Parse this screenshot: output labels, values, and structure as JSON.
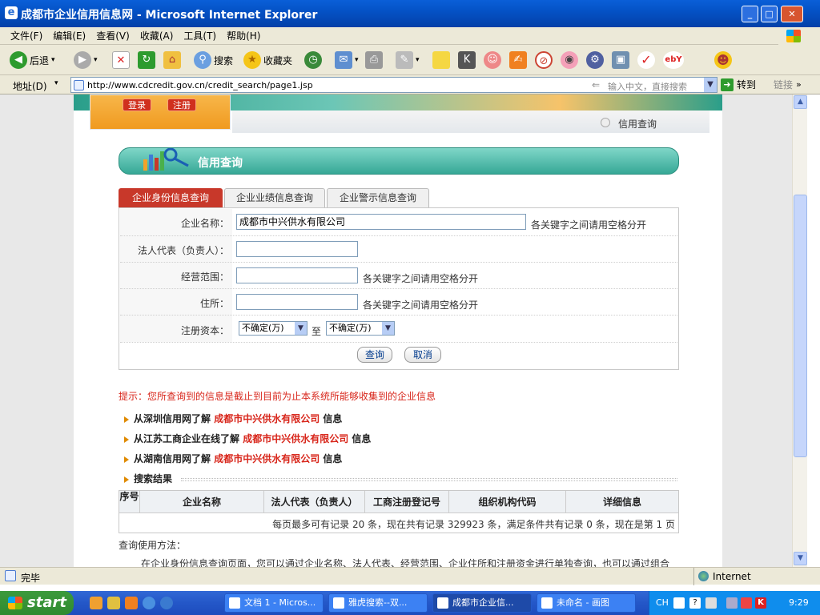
{
  "window": {
    "title": "成都市企业信用信息网 - Microsoft Internet Explorer"
  },
  "menu": [
    "文件(F)",
    "编辑(E)",
    "查看(V)",
    "收藏(A)",
    "工具(T)",
    "帮助(H)"
  ],
  "toolbar": {
    "back": "后退",
    "search": "搜索",
    "favorites": "收藏夹"
  },
  "address": {
    "label": "地址(D)",
    "url": "http://www.cdcredit.gov.cn/credit_search/page1.jsp",
    "search_hint": "输入中文，直接搜索",
    "go": "转到",
    "links": "链接"
  },
  "header": {
    "login": "登录",
    "register": "注册",
    "nav_credit": "信用查询",
    "section_title": "信用查询"
  },
  "tabs": [
    "企业身份信息查询",
    "企业业绩信息查询",
    "企业警示信息查询"
  ],
  "form": {
    "company_name_label": "企业名称：",
    "company_name_value": "成都市中兴供水有限公司",
    "company_hint": "各关键字之间请用空格分开",
    "legal_rep_label": "法人代表（负责人）：",
    "legal_rep_value": "",
    "scope_label": "经营范围：",
    "scope_hint": "各关键字之间请用空格分开",
    "address_label": "住所：",
    "address_hint": "各关键字之间请用空格分开",
    "capital_label": "注册资本：",
    "capital_from": "不确定(万)",
    "capital_to_word": "至",
    "capital_to": "不确定(万)",
    "query_button": "查询",
    "cancel_button": "取消"
  },
  "notice": "提示：您所查询到的信息是截止到目前为止本系统所能够收集到的企业信息",
  "links": [
    {
      "prefix": "从深圳信用网了解",
      "company": "成都市中兴供水有限公司",
      "suffix": "信息"
    },
    {
      "prefix": "从江苏工商企业在线了解",
      "company": "成都市中兴供水有限公司",
      "suffix": "信息"
    },
    {
      "prefix": "从湖南信用网了解",
      "company": "成都市中兴供水有限公司",
      "suffix": "信息"
    }
  ],
  "results": {
    "title": "搜索结果",
    "columns": [
      "序号",
      "企业名称",
      "法人代表（负责人）",
      "工商注册登记号",
      "组织机构代码",
      "详细信息"
    ],
    "summary": "每页最多可有记录 20 条，现在共有记录 329923 条，满足条件共有记录 0 条，现在是第 1 页"
  },
  "usage": {
    "title": "查询使用方法：",
    "text": "在企业身份信息查询页面，您可以通过企业名称、法人代表、经营范围、企业住所和注册资金进行单独查询，也可以通过组合"
  },
  "status": {
    "left": "完毕",
    "zone": "Internet"
  },
  "taskbar": {
    "start": "start",
    "tasks": [
      "文档 1 - Micros...",
      "雅虎搜索--双...",
      "成都市企业信...",
      "未命名 - 画图"
    ],
    "lang": "CH",
    "clock": "9:29"
  }
}
